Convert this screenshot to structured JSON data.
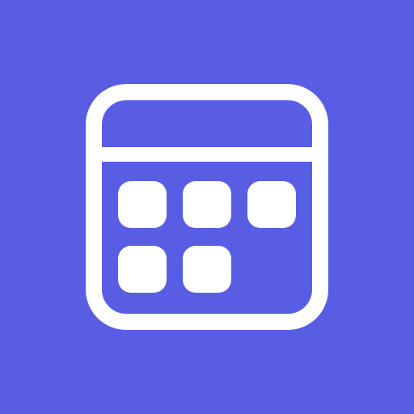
{
  "icon": {
    "name": "calendar-icon",
    "background_color": "#585EE4",
    "foreground_color": "#FFFFFF"
  }
}
